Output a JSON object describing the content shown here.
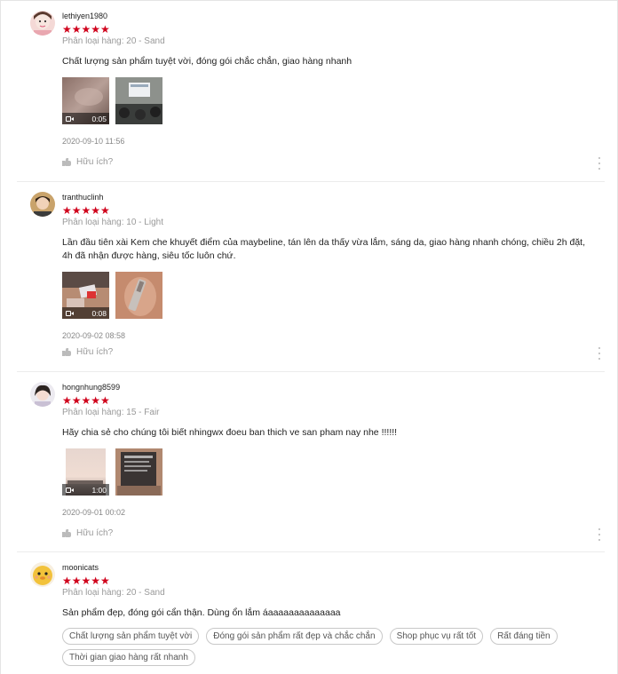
{
  "reviews": [
    {
      "username": "lethiyen1980",
      "rating": 5,
      "stars": "★★★★★",
      "variation": "Phân loại hàng: 20 - Sand",
      "comment": "Chất lượng sản phẩm tuyệt vời, đóng gói chắc chắn, giao hàng nhanh",
      "video_duration": "0:05",
      "date": "2020-09-10 11:56",
      "helpful_label": "Hữu ích?"
    },
    {
      "username": "tranthuclinh",
      "rating": 5,
      "stars": "★★★★★",
      "variation": "Phân loại hàng: 10 - Light",
      "comment": "Lần đầu tiên xài Kem che khuyết điểm của maybeline, tán lên da thấy vừa lắm, sáng da, giao hàng nhanh chóng, chiều 2h đặt, 4h đã nhận được hàng, siêu tốc luôn chứ.",
      "video_duration": "0:08",
      "date": "2020-09-02 08:58",
      "helpful_label": "Hữu ích?"
    },
    {
      "username": "hongnhung8599",
      "rating": 5,
      "stars": "★★★★★",
      "variation": "Phân loại hàng: 15 - Fair",
      "comment": "Hãy chia sẻ cho chúng tôi biết nhingwx đoeu ban thich ve san pham nay nhe !!!!!!",
      "video_duration": "1:00",
      "date": "2020-09-01 00:02",
      "helpful_label": "Hữu ích?"
    },
    {
      "username": "moonicats",
      "rating": 5,
      "stars": "★★★★★",
      "variation": "Phân loại hàng: 20 - Sand",
      "comment": "Sản phẩm đẹp, đóng gói cẩn thận. Dùng ổn lắm áaaaaaaaaaaaaaa",
      "tags": [
        "Chất lượng sản phẩm tuyệt vời",
        "Đóng gói sản phẩm rất đẹp và chắc chắn",
        "Shop phục vụ rất tốt",
        "Rất đáng tiền",
        "Thời gian giao hàng rất nhanh"
      ]
    }
  ],
  "colors": {
    "star": "#d0011b",
    "muted": "#999999"
  },
  "icons": {
    "like": "thumb-up-icon",
    "video": "video-camera-icon",
    "more": "more-vertical-icon"
  }
}
